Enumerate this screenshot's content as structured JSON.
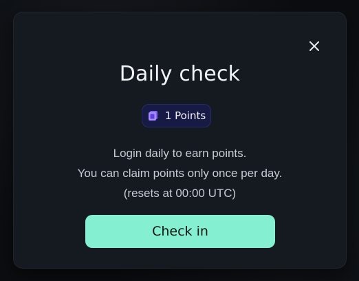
{
  "modal": {
    "title": "Daily check",
    "points_badge": {
      "icon": "coin-stack-icon",
      "label": "1 Points",
      "color": "#181a46"
    },
    "description_lines": [
      "Login daily to earn points.",
      "You can claim points only once per day.",
      "(resets at 00:00 UTC)"
    ],
    "close_icon": "close-icon",
    "primary_button": {
      "label": "Check in",
      "color": "#84f0d1"
    }
  }
}
